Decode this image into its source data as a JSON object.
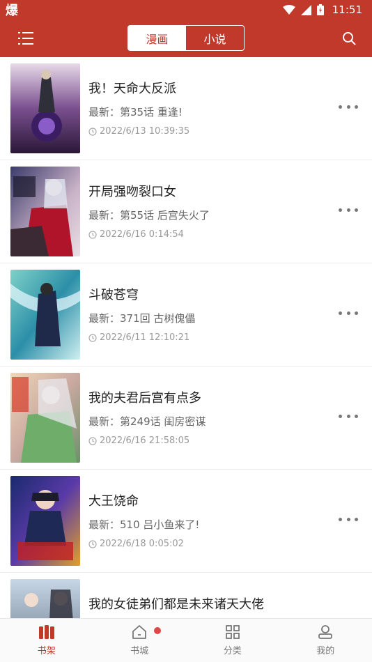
{
  "status_bar": {
    "app_icon_text": "爆",
    "time": "11:51"
  },
  "header": {
    "tabs": [
      {
        "label": "漫画",
        "active": true
      },
      {
        "label": "小说",
        "active": false
      }
    ],
    "accent_color": "#c0392b"
  },
  "books": [
    {
      "title": "我！天命大反派",
      "latest": "最新：第35话 重逢!",
      "time": "2022/6/13 10:39:35"
    },
    {
      "title": "开局强吻裂口女",
      "latest": "最新：第55话 后宫失火了",
      "time": "2022/6/16 0:14:54"
    },
    {
      "title": "斗破苍穹",
      "latest": "最新：371回 古树傀儡",
      "time": "2022/6/11 12:10:21"
    },
    {
      "title": "我的夫君后宫有点多",
      "latest": "最新：第249话 闺房密谋",
      "time": "2022/6/16 21:58:05"
    },
    {
      "title": "大王饶命",
      "latest": "最新：510 吕小鱼来了!",
      "time": "2022/6/18 0:05:02"
    },
    {
      "title": "我的女徒弟们都是未来诸天大佬",
      "latest": "",
      "time": ""
    }
  ],
  "bottom_nav": [
    {
      "label": "书架",
      "icon": "bookshelf-icon",
      "active": true
    },
    {
      "label": "书城",
      "icon": "home-icon",
      "active": false,
      "badge": true
    },
    {
      "label": "分类",
      "icon": "grid-icon",
      "active": false
    },
    {
      "label": "我的",
      "icon": "user-icon",
      "active": false
    }
  ]
}
